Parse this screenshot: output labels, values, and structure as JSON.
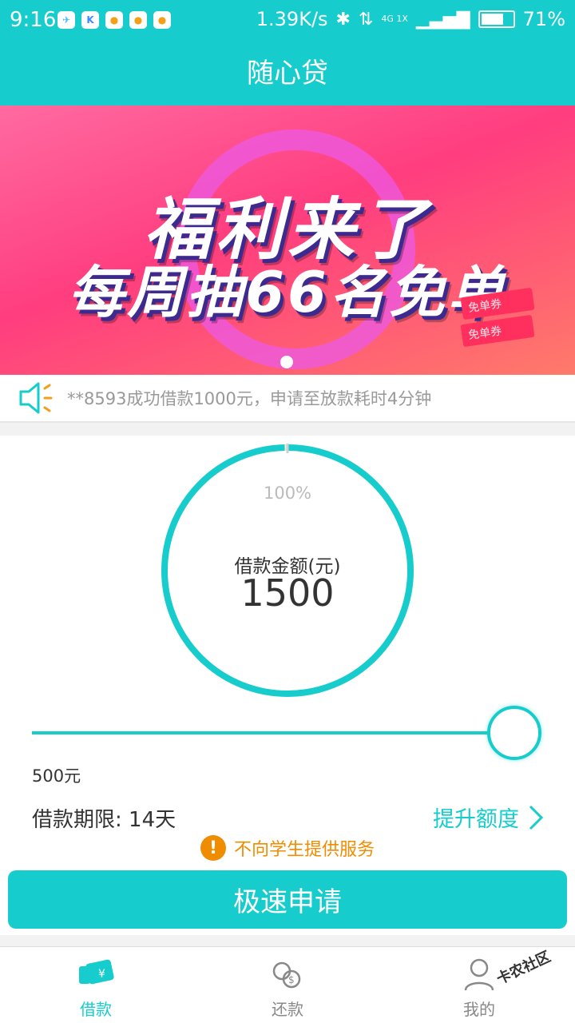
{
  "status_bar": {
    "time": "9:16",
    "speed": "1.39K/s",
    "network": "4G 1X",
    "battery": "71%",
    "battery_level": 0.71,
    "app_icons": [
      {
        "glyph": "✈",
        "bg": "#3cb8ff"
      },
      {
        "glyph": "K",
        "bg": "#3a8bff"
      },
      {
        "glyph": "●",
        "bg": "#f3a018"
      },
      {
        "glyph": "●",
        "bg": "#f3a018"
      },
      {
        "glyph": "●",
        "bg": "#f3a018"
      }
    ]
  },
  "header": {
    "title": "随心贷"
  },
  "banner": {
    "line1": "福利来了",
    "line2": "每周抽66名免单",
    "coupon": "免单券"
  },
  "notice": {
    "text": "**8593成功借款1000元，申请至放款耗时4分钟"
  },
  "loan": {
    "percent_text": "100%",
    "progress": 1.0,
    "amount_label": "借款金额(元)",
    "amount_value": "1500",
    "slider_level": 1.0,
    "min_label": "500元",
    "term_label": "借款期限: 14天",
    "raise_label": "提升额度",
    "warning_text": "不向学生提供服务",
    "apply_label": "极速申请"
  },
  "tabs": [
    {
      "label": "借款",
      "icon": "loan-icon",
      "active": true
    },
    {
      "label": "还款",
      "icon": "repay-icon",
      "active": false
    },
    {
      "label": "我的",
      "icon": "profile-icon",
      "active": false
    }
  ],
  "watermark": "卡农社区",
  "colors": {
    "accent": "#17cccc",
    "warning": "#f08c00",
    "banner_pink": "#ff3d7f"
  }
}
